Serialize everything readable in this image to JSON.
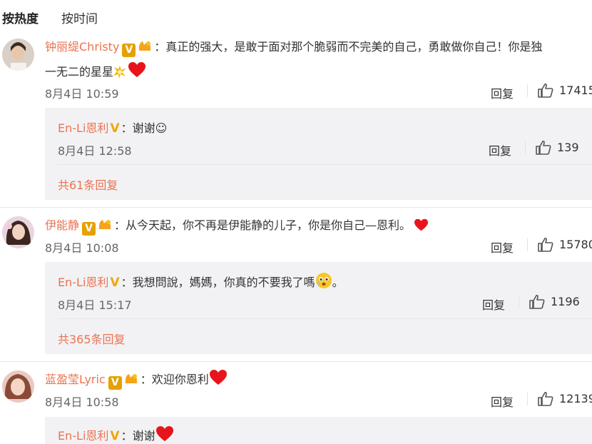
{
  "tabs": {
    "hot": "按热度",
    "time": "按时间"
  },
  "comments": [
    {
      "user": "钟丽缇Christy",
      "text_line1": "：真正的强大，是敢于面对那个脆弱而不完美的自己，勇敢做你自己！你是独",
      "text_line2": "一无二的星星",
      "time": "8月4日 10:59",
      "reply_label": "回复",
      "likes": "17415",
      "sub_reply": {
        "user": "En-Li恩利",
        "text": "：谢谢☺",
        "time": "8月4日 12:58",
        "reply_label": "回复",
        "likes": "139"
      },
      "more_replies": "共61条回复"
    },
    {
      "user": "伊能静",
      "text": "：从今天起，你不再是伊能静的儿子，你是你自己—恩利。",
      "time": "8月4日 10:08",
      "reply_label": "回复",
      "likes": "15780",
      "sub_reply": {
        "user": "En-Li恩利",
        "text": "：我想問說，媽媽，你真的不要我了嗎",
        "text_tail": "。",
        "time": "8月4日 15:17",
        "reply_label": "回复",
        "likes": "1196"
      },
      "more_replies": "共365条回复"
    },
    {
      "user": "蓝盈莹Lyric",
      "text": "：欢迎你恩利",
      "time": "8月4日 10:58",
      "reply_label": "回复",
      "likes": "12139",
      "sub_reply": {
        "user": "En-Li恩利",
        "text": "：谢谢"
      }
    }
  ],
  "badges": {
    "verified": "V"
  },
  "icons": [
    "thumb-up-icon",
    "heart-icon",
    "fan-badge-icon",
    "sparkle-icon",
    "crying-face-icon"
  ],
  "colors": {
    "username": "#eb7350",
    "verified_badge": "#e6a100",
    "heart": "#e8141c",
    "subreply_bg": "#f2f2f5"
  }
}
